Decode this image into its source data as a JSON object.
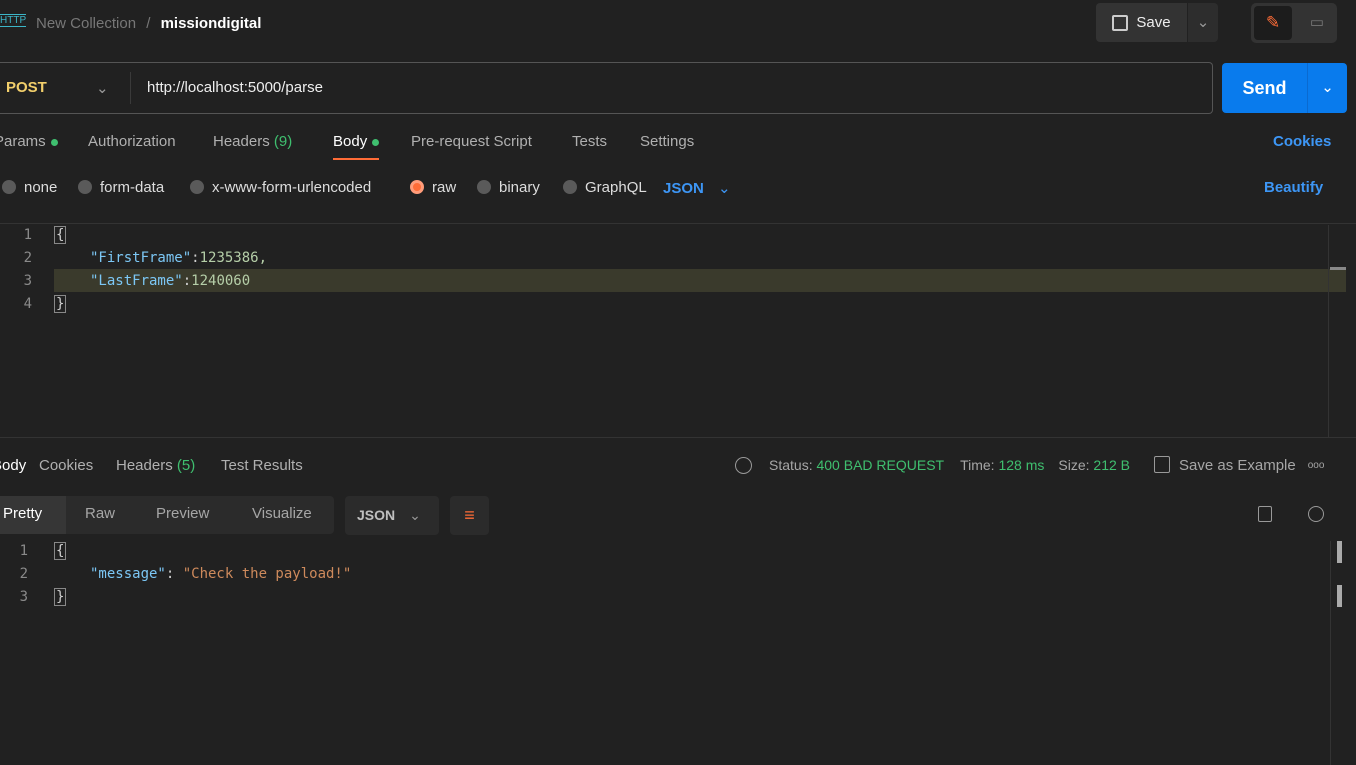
{
  "header": {
    "collection": "New Collection",
    "separator": "/",
    "request_name": "missiondigital",
    "save_label": "Save",
    "http_badge": "HTTP"
  },
  "request": {
    "method": "POST",
    "url": "http://localhost:5000/parse",
    "send_label": "Send"
  },
  "req_tabs": [
    {
      "label": "Params"
    },
    {
      "label": "Authorization"
    },
    {
      "label": "Headers",
      "count": "(9)"
    },
    {
      "label": "Body"
    },
    {
      "label": "Pre-request Script"
    },
    {
      "label": "Tests"
    },
    {
      "label": "Settings"
    }
  ],
  "cookies_label": "Cookies",
  "body_types": [
    "none",
    "form-data",
    "x-www-form-urlencoded",
    "raw",
    "binary",
    "GraphQL"
  ],
  "body_format": "JSON",
  "beautify_label": "Beautify",
  "request_body": {
    "lines": [
      "1",
      "2",
      "3",
      "4"
    ],
    "open": "{",
    "k1": "\"FirstFrame\"",
    "v1": "1235386,",
    "k2": "\"LastFrame\"",
    "v2": "1240060",
    "close": "}",
    "colon": ":"
  },
  "resp_tabs": [
    {
      "label": "Body"
    },
    {
      "label": "Cookies"
    },
    {
      "label": "Headers",
      "count": "(5)"
    },
    {
      "label": "Test Results"
    }
  ],
  "status": {
    "status_label": "Status:",
    "status_value": "400 BAD REQUEST",
    "time_label": "Time:",
    "time_value": "128 ms",
    "size_label": "Size:",
    "size_value": "212 B",
    "save_example": "Save as Example",
    "more": "ooo"
  },
  "view_tabs": [
    "Pretty",
    "Raw",
    "Preview",
    "Visualize"
  ],
  "resp_format": "JSON",
  "response_body": {
    "lines": [
      "1",
      "2",
      "3"
    ],
    "open": "{",
    "key": "\"message\"",
    "colon": ": ",
    "value": "\"Check the payload!\"",
    "close": "}"
  },
  "colors": {
    "accent": "#ff6c37",
    "send": "#097bed",
    "link": "#3d96f5",
    "success": "#3fbf6f"
  }
}
